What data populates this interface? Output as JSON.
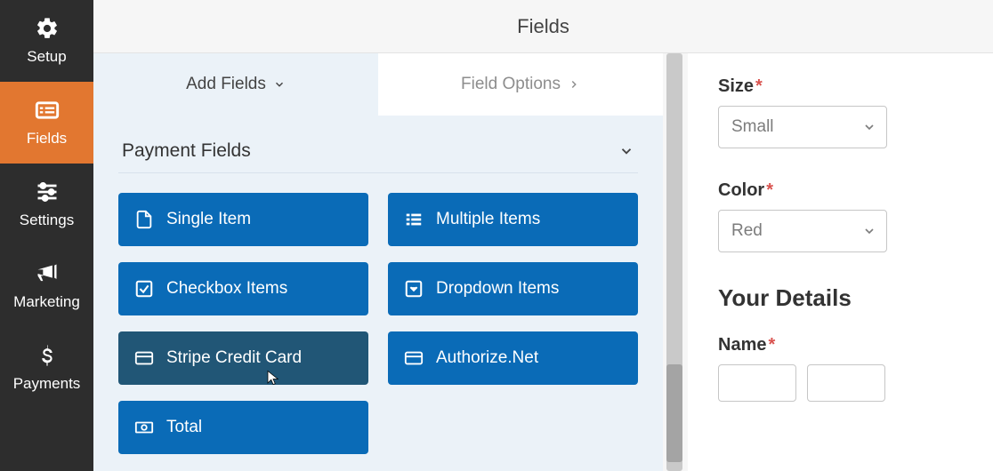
{
  "sidebar": {
    "items": [
      {
        "label": "Setup"
      },
      {
        "label": "Fields"
      },
      {
        "label": "Settings"
      },
      {
        "label": "Marketing"
      },
      {
        "label": "Payments"
      }
    ]
  },
  "header": {
    "title": "Fields"
  },
  "tabs": {
    "add": "Add Fields",
    "options": "Field Options"
  },
  "panel": {
    "section": "Payment Fields",
    "buttons": [
      "Single Item",
      "Multiple Items",
      "Checkbox Items",
      "Dropdown Items",
      "Stripe Credit Card",
      "Authorize.Net",
      "Total"
    ]
  },
  "preview": {
    "size": {
      "label": "Size",
      "required": "*",
      "value": "Small"
    },
    "color": {
      "label": "Color",
      "required": "*",
      "value": "Red"
    },
    "details": {
      "title": "Your Details"
    },
    "name": {
      "label": "Name",
      "required": "*"
    }
  }
}
